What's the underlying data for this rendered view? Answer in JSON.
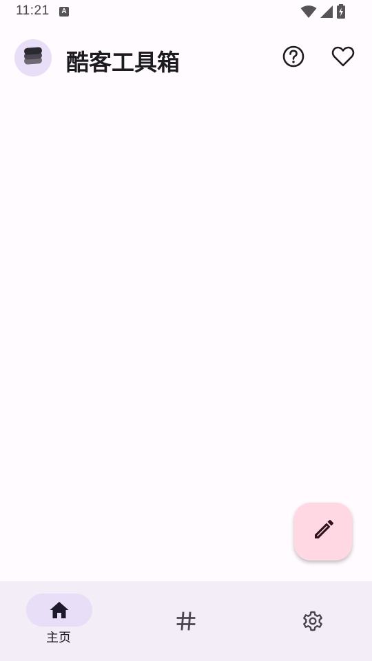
{
  "status_bar": {
    "time": "11:21",
    "notification_icon": "text-a-icon",
    "icons": [
      "wifi-icon",
      "signal-icon",
      "battery-charging-icon"
    ]
  },
  "app_bar": {
    "title": "酷客工具箱",
    "logo_icon": "layers-stack-icon",
    "actions": [
      {
        "name": "help",
        "icon": "help-circle-icon"
      },
      {
        "name": "favorite",
        "icon": "heart-outline-icon"
      }
    ]
  },
  "fab": {
    "icon": "pencil-icon"
  },
  "bottom_nav": {
    "items": [
      {
        "label": "主页",
        "icon": "home-icon",
        "selected": true
      },
      {
        "label": "",
        "icon": "hash-icon",
        "selected": false
      },
      {
        "label": "",
        "icon": "gear-icon",
        "selected": false
      }
    ]
  },
  "colors": {
    "background": "#fffbfe",
    "nav_background": "#f3edf7",
    "indicator": "#e8def8",
    "fab": "#ffd8e4",
    "icon": "#49454f"
  }
}
